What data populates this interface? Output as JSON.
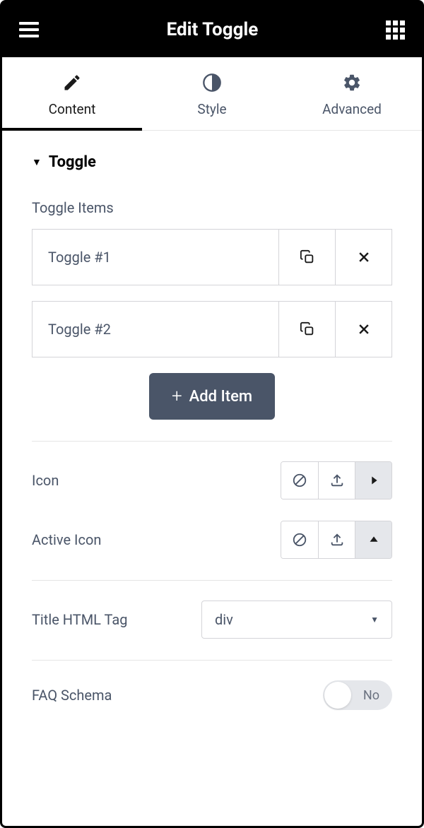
{
  "header": {
    "title": "Edit Toggle"
  },
  "tabs": [
    {
      "label": "Content",
      "active": true
    },
    {
      "label": "Style",
      "active": false
    },
    {
      "label": "Advanced",
      "active": false
    }
  ],
  "section": {
    "title": "Toggle"
  },
  "toggle_items": {
    "label": "Toggle Items",
    "items": [
      {
        "title": "Toggle #1"
      },
      {
        "title": "Toggle #2"
      }
    ],
    "add_label": "Add Item"
  },
  "icon_control": {
    "label": "Icon"
  },
  "active_icon_control": {
    "label": "Active Icon"
  },
  "title_tag": {
    "label": "Title HTML Tag",
    "value": "div"
  },
  "faq_schema": {
    "label": "FAQ Schema",
    "value": "No"
  }
}
